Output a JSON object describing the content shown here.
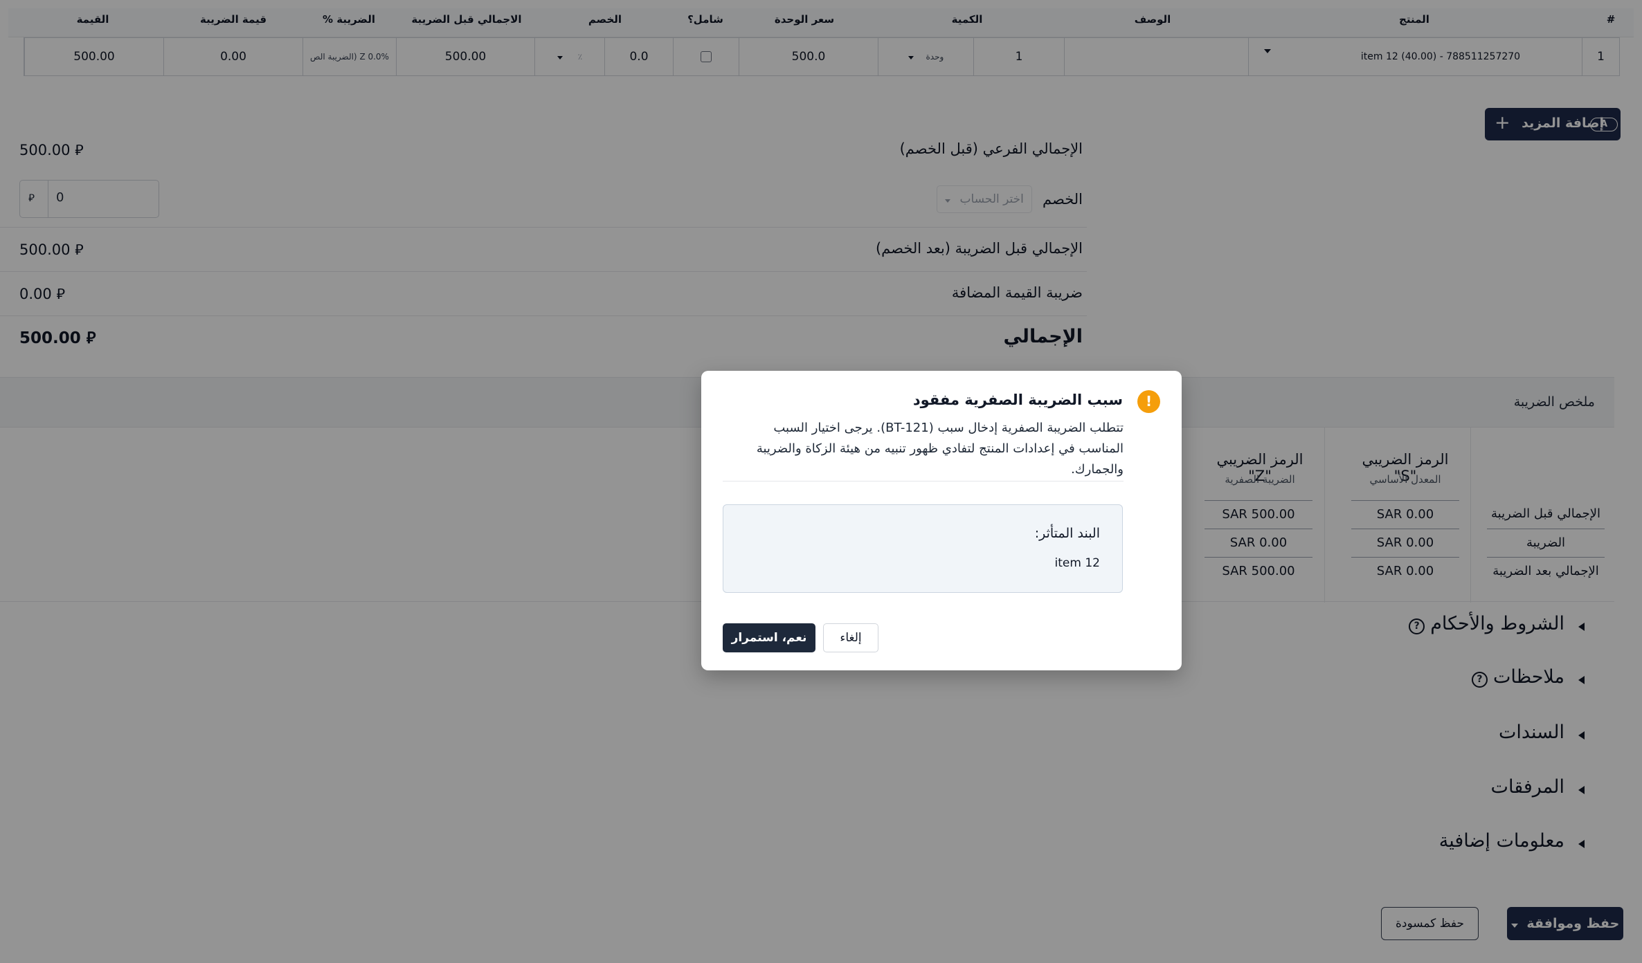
{
  "table": {
    "headers": {
      "row_num": "#",
      "product": "المنتج",
      "description": "الوصف",
      "quantity": "الكمية",
      "unit_price": "سعر الوحدة",
      "inclusive": "شامل؟",
      "discount": "الخصم",
      "total_before_tax": "الاجمالي قبل الضريبة",
      "tax_pct": "الضريبة %",
      "tax_amount": "قيمة الضريبة",
      "amount": "القيمة"
    },
    "row": {
      "num": "1",
      "product": "item 12 (40.00) - 788511257270",
      "quantity": "1",
      "unit": "وحدة",
      "unit_price": "500.0",
      "discount_value": "0.0",
      "discount_type": "٪",
      "total_before_tax": "500.00",
      "tax": "Z 0.0% (الضريبة الص",
      "tax_amount": "0.00",
      "amount": "500.00"
    }
  },
  "add_more": {
    "label": "إضافة المزيد",
    "shortcut_key": "A"
  },
  "totals": {
    "subtotal_label": "الإجمالي الفرعي (قبل الخصم)",
    "subtotal_value": "500.00",
    "discount_label": "الخصم",
    "account_placeholder": "اختر الحساب",
    "discount_value": "0",
    "pre_tax_label": "الإجمالي قبل الضريبة (بعد الخصم)",
    "pre_tax_value": "500.00",
    "vat_label": "ضريبة القيمة المضافة",
    "vat_value": "0.00",
    "grand_label": "الإجمالي",
    "grand_value": "500.00",
    "currency_symbol": "⃁"
  },
  "tax_summary": {
    "title": "ملخص الضريبة",
    "row_labels": [
      "الإجمالي قبل الضريبة",
      "الضريبة",
      "الإجمالي بعد الضريبة"
    ],
    "columns": [
      {
        "title": "الرمز الضريبي \"S\"",
        "subtitle": "المعدل الأساسي",
        "values": [
          "SAR 0.00",
          "SAR 0.00",
          "SAR 0.00"
        ]
      },
      {
        "title": "الرمز الضريبي \"Z\"",
        "subtitle": "الضريبة الصفرية",
        "values": [
          "SAR 500.00",
          "SAR 0.00",
          "SAR 500.00"
        ]
      }
    ]
  },
  "sections": {
    "terms": "الشروط والأحكام",
    "notes": "ملاحظات",
    "vouchers": "السندات",
    "attachments": "المرفقات",
    "extra": "معلومات إضافية"
  },
  "footer": {
    "save_draft": "حفظ كمسودة",
    "save_approve": "حفظ وموافقة"
  },
  "modal": {
    "title": "سبب الضريبة الصفرية مفقود",
    "body": "تتطلب الضريبة الصفرية إدخال سبب (BT-121). يرجى اختيار السبب المناسب في إعدادات المنتج لتفادي ظهور تنبيه من هيئة الزكاة والضريبة والجمارك.",
    "affected_title": "البند المتأثر:",
    "affected_item": "item 12",
    "confirm": "نعم، استمرار",
    "cancel": "إلغاء"
  },
  "colors": {
    "primary": "#1e2a4a",
    "warning": "#f59e0b"
  }
}
